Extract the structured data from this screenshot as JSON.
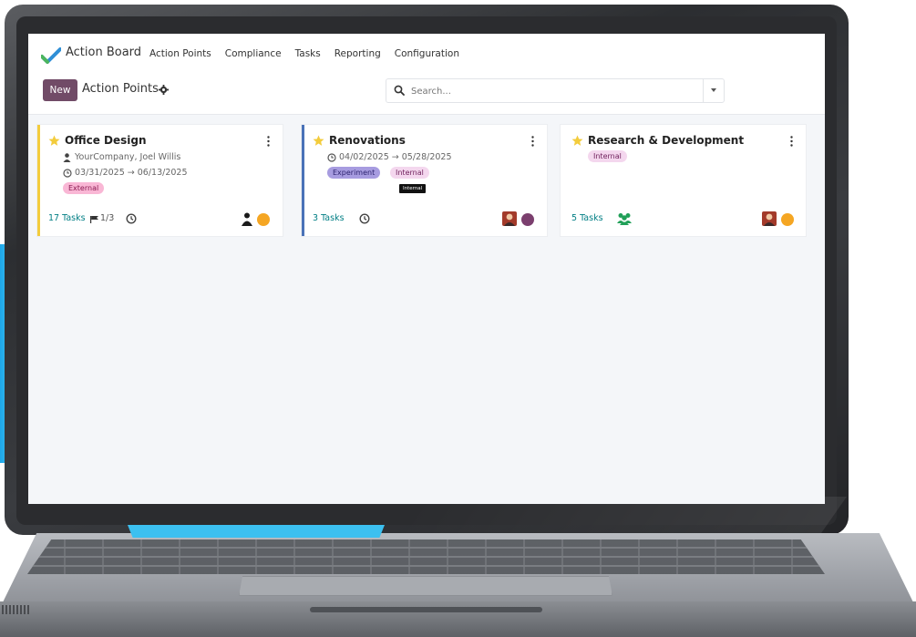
{
  "app": {
    "name": "Action Board",
    "menu": [
      "Action Points",
      "Compliance",
      "Tasks",
      "Reporting",
      "Configuration"
    ]
  },
  "control": {
    "new_label": "New",
    "breadcrumb": "Action Points",
    "search_placeholder": "Search..."
  },
  "cards": [
    {
      "title": "Office Design",
      "partner": "YourCompany, Joel Willis",
      "dates": "03/31/2025 → 06/13/2025",
      "tags": [
        "External"
      ],
      "tasks": "17 Tasks",
      "milestones": "1/3",
      "accent_color": "#f3cc3c"
    },
    {
      "title": "Renovations",
      "dates": "04/02/2025 → 05/28/2025",
      "tags": [
        "Experiment",
        "Internal"
      ],
      "tooltip": "Internal",
      "tasks": "3 Tasks",
      "accent_color": "#4a72b8"
    },
    {
      "title": "Research & Development",
      "tags": [
        "Internal"
      ],
      "tasks": "5 Tasks"
    }
  ],
  "colors": {
    "brand": "#714b67",
    "tasks_link": "#017e84",
    "star": "#f3cc3c",
    "tag_external": "#f9b7d5",
    "tag_experiment": "#a79ce0",
    "tag_internal": "#f4d7ee",
    "dot_orange": "#f5a623",
    "dot_purple": "#7b3f6e",
    "dot_green": "#21a058"
  }
}
